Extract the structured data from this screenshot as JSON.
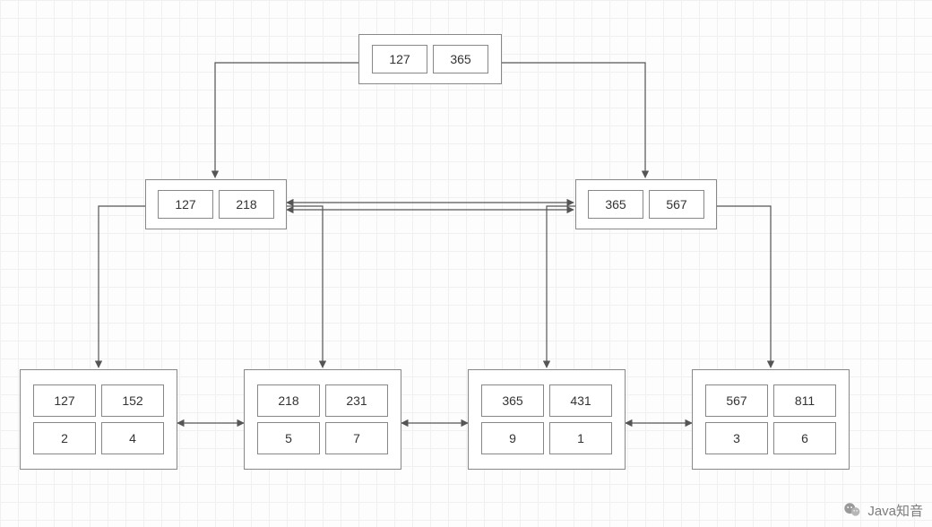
{
  "root": {
    "keys": [
      "127",
      "365"
    ]
  },
  "mid": [
    {
      "keys": [
        "127",
        "218"
      ]
    },
    {
      "keys": [
        "365",
        "567"
      ]
    }
  ],
  "leaves": [
    {
      "top": [
        "127",
        "152"
      ],
      "bottom": [
        "2",
        "4"
      ]
    },
    {
      "top": [
        "218",
        "231"
      ],
      "bottom": [
        "5",
        "7"
      ]
    },
    {
      "top": [
        "365",
        "431"
      ],
      "bottom": [
        "9",
        "1"
      ]
    },
    {
      "top": [
        "567",
        "811"
      ],
      "bottom": [
        "3",
        "6"
      ]
    }
  ],
  "watermark": {
    "icon_label": "wechat-icon",
    "text": "Java知音"
  }
}
